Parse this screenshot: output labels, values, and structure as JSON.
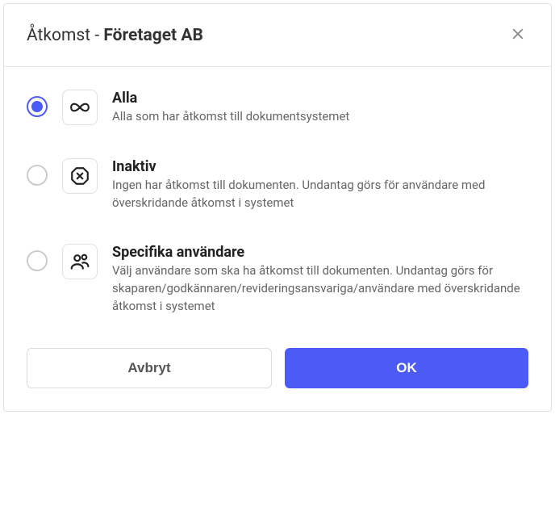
{
  "header": {
    "title_prefix": "Åtkomst - ",
    "title_company": "Företaget AB"
  },
  "options": [
    {
      "id": "all",
      "title": "Alla",
      "description": "Alla som har åtkomst till dokumentsystemet",
      "selected": true
    },
    {
      "id": "inactive",
      "title": "Inaktiv",
      "description": "Ingen har åtkomst till dokumenten. Undantag görs för användare med överskridande åtkomst i systemet",
      "selected": false
    },
    {
      "id": "specific",
      "title": "Specifika användare",
      "description": "Välj användare som ska ha åtkomst till dokumenten. Undantag görs för skaparen/godkännaren/revideringsansvariga/användare med överskridande åtkomst i systemet",
      "selected": false
    }
  ],
  "footer": {
    "cancel_label": "Avbryt",
    "ok_label": "OK"
  }
}
